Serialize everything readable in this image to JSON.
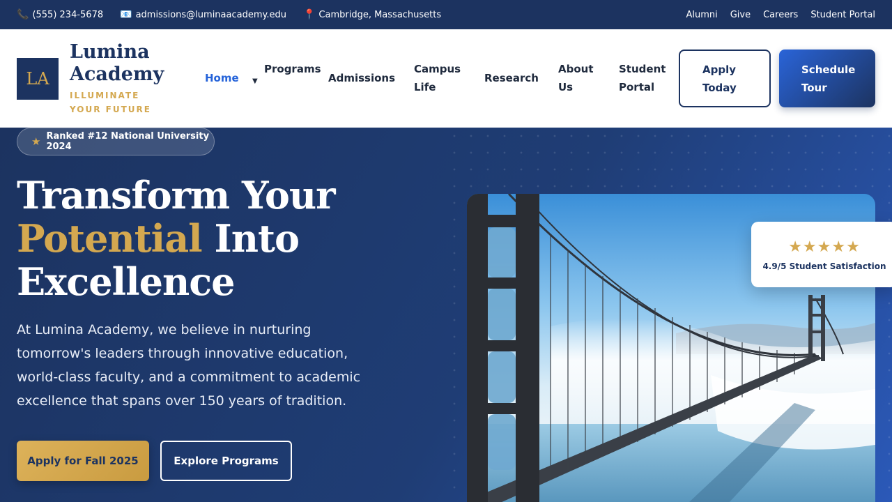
{
  "topbar": {
    "phone": "(555) 234-5678",
    "email": "admissions@luminaacademy.edu",
    "location": "Cambridge, Massachusetts",
    "links": [
      "Alumni",
      "Give",
      "Careers",
      "Student Portal"
    ]
  },
  "logo": {
    "mark": "LA",
    "name": "Lumina Academy",
    "tagline": "ILLUMINATE YOUR FUTURE"
  },
  "nav": {
    "items": [
      {
        "label": "Home",
        "active": true
      },
      {
        "label": "Programs",
        "dropdown": true
      },
      {
        "label": "Admissions"
      },
      {
        "label": "Campus Life"
      },
      {
        "label": "Research"
      },
      {
        "label": "About Us"
      },
      {
        "label": "Student Portal"
      }
    ],
    "apply_label": "Apply Today",
    "tour_label": "Schedule Tour"
  },
  "hero": {
    "badge": "Ranked #12 National University 2024",
    "headline_line1": "Transform Your",
    "headline_gold": "Potential",
    "headline_line2_rest": " Into",
    "headline_line3": "Excellence",
    "lede": "At Lumina Academy, we believe in nurturing tomorrow's leaders through innovative education, world-class faculty, and a commitment to academic excellence that spans over 150 years of tradition.",
    "cta_primary": "Apply for Fall 2025",
    "cta_secondary": "Explore Programs"
  },
  "rating": {
    "stars": "★★★★★",
    "score": "4.9/5 Student Satisfaction"
  },
  "colors": {
    "navy": "#1c3360",
    "gold": "#d4a850",
    "accent_blue": "#2563d9"
  }
}
